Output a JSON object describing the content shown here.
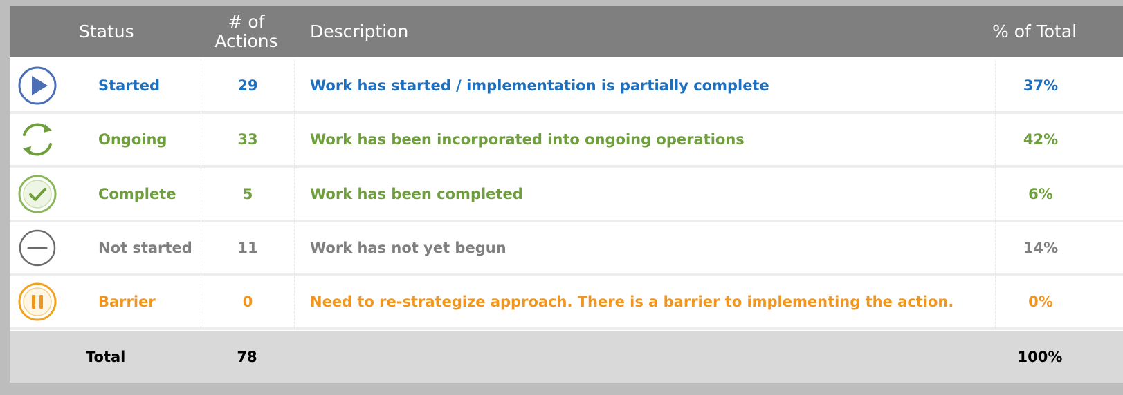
{
  "header": {
    "status_label": "Status",
    "actions_label_line1": "# of",
    "actions_label_line2": "Actions",
    "description_label": "Description",
    "percent_label": "% of Total"
  },
  "colors": {
    "started": "#1f6fbf",
    "ongoing": "#6f9e3c",
    "complete": "#6f9e3c",
    "not_started": "#7f7f7f",
    "barrier": "#f0961e",
    "header_bg": "#7f7f7f",
    "total_bg": "#d9d9d9"
  },
  "rows": [
    {
      "icon": "play-circle-icon",
      "status": "Started",
      "actions": "29",
      "description": "Work has started / implementation is partially complete",
      "percent": "37%"
    },
    {
      "icon": "refresh-cycle-icon",
      "status": "Ongoing",
      "actions": "33",
      "description": "Work has been incorporated into ongoing operations",
      "percent": "42%"
    },
    {
      "icon": "check-circle-icon",
      "status": "Complete",
      "actions": "5",
      "description": "Work has been completed",
      "percent": "6%"
    },
    {
      "icon": "minus-circle-icon",
      "status": "Not started",
      "actions": "11",
      "description": "Work has not yet begun",
      "percent": "14%"
    },
    {
      "icon": "pause-circle-icon",
      "status": "Barrier",
      "actions": "0",
      "description": "Need to re-strategize approach. There is a barrier to implementing the action.",
      "percent": "0%"
    }
  ],
  "total": {
    "label": "Total",
    "actions": "78",
    "percent": "100%"
  }
}
